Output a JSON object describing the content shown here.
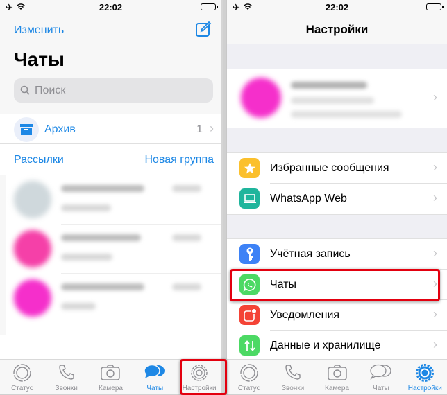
{
  "status_bar": {
    "time": "22:02",
    "icons": [
      "airplane-icon",
      "wifi-icon",
      "battery-icon"
    ]
  },
  "left": {
    "edit_label": "Изменить",
    "compose_icon": "compose-icon",
    "title": "Чаты",
    "search": {
      "placeholder": "Поиск",
      "icon": "search-icon"
    },
    "archive": {
      "label": "Архив",
      "count": "1",
      "icon": "archive-box-icon"
    },
    "broadcast_label": "Рассылки",
    "new_group_label": "Новая группа",
    "chats": [
      {
        "name": "blurred",
        "avatar_color": "#cfd8dc"
      },
      {
        "name": "blurred",
        "avatar_color": "#f540a8"
      },
      {
        "name": "blurred",
        "avatar_color": "#f52fcb"
      }
    ],
    "tabs": [
      {
        "label": "Статус",
        "icon": "status-icon",
        "active": false
      },
      {
        "label": "Звонки",
        "icon": "phone-icon",
        "active": false
      },
      {
        "label": "Камера",
        "icon": "camera-icon",
        "active": false
      },
      {
        "label": "Чаты",
        "icon": "chats-icon",
        "active": true
      },
      {
        "label": "Настройки",
        "icon": "settings-gear-icon",
        "active": false,
        "highlighted": true
      }
    ]
  },
  "right": {
    "title": "Настройки",
    "profile": {
      "name": "blurred",
      "avatar_color": "#f52fcb"
    },
    "group1": [
      {
        "label": "Избранные сообщения",
        "icon": "star-icon",
        "color": "#fbc02d"
      },
      {
        "label": "WhatsApp Web",
        "icon": "laptop-icon",
        "color": "#1fb59c"
      }
    ],
    "group2": [
      {
        "label": "Учётная запись",
        "icon": "key-icon",
        "color": "#3d82f6"
      },
      {
        "label": "Чаты",
        "icon": "whatsapp-icon",
        "color": "#4cd964",
        "highlighted": true
      },
      {
        "label": "Уведомления",
        "icon": "notification-icon",
        "color": "#f44336"
      },
      {
        "label": "Данные и хранилище",
        "icon": "data-arrows-icon",
        "color": "#4cd964"
      }
    ],
    "tabs": [
      {
        "label": "Статус",
        "icon": "status-icon",
        "active": false
      },
      {
        "label": "Звонки",
        "icon": "phone-icon",
        "active": false
      },
      {
        "label": "Камера",
        "icon": "camera-icon",
        "active": false
      },
      {
        "label": "Чаты",
        "icon": "chats-icon",
        "active": false
      },
      {
        "label": "Настройки",
        "icon": "settings-gear-icon",
        "active": true
      }
    ]
  },
  "colors": {
    "accent": "#1e88e5",
    "highlight": "#e3000f"
  }
}
